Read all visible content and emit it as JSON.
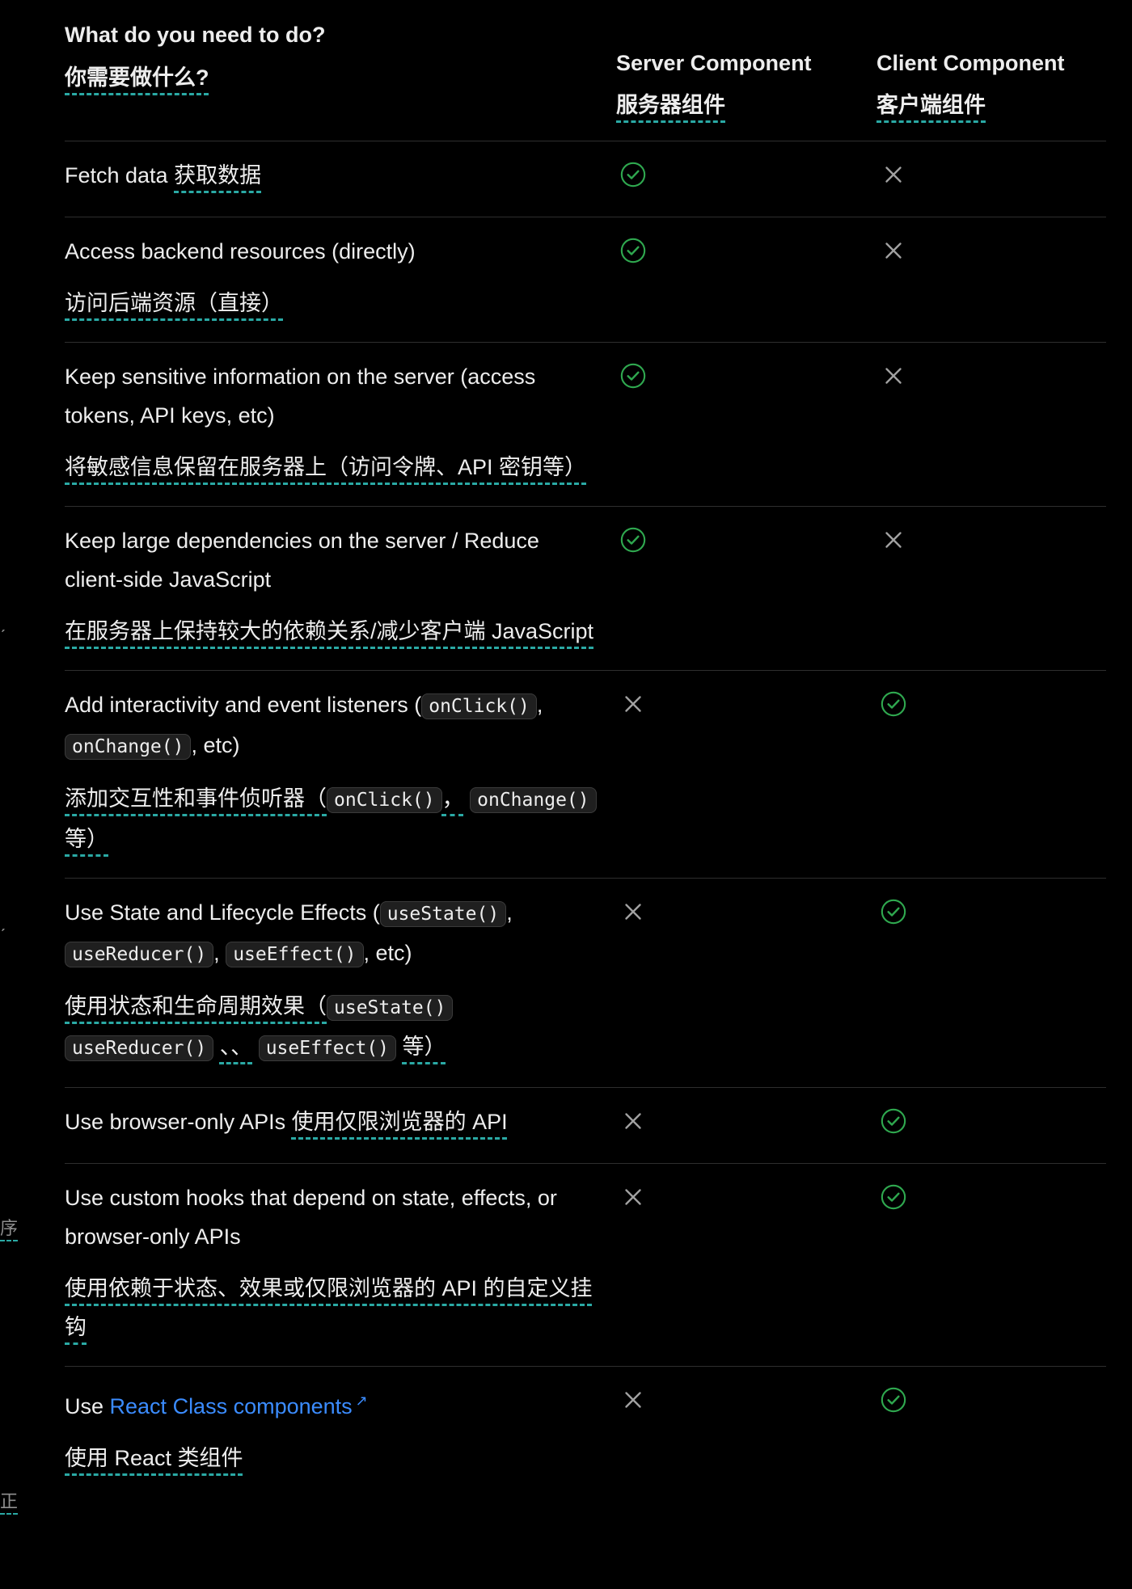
{
  "header": {
    "task_en": "What do you need to do?",
    "task_zh": "你需要做什么?",
    "server_en": "Server Component",
    "server_zh": "服务器组件",
    "client_en": "Client Component",
    "client_zh": "客户端组件"
  },
  "left_edge": {
    "mark1": "序",
    "mark2": "正"
  },
  "rows": [
    {
      "en": "Fetch data",
      "zh": "获取数据",
      "server": "check",
      "client": "x"
    },
    {
      "en": "Access backend resources (directly)",
      "zh": "访问后端资源（直接）",
      "server": "check",
      "client": "x"
    },
    {
      "en": "Keep sensitive information on the server (access tokens, API keys, etc)",
      "zh": "将敏感信息保留在服务器上（访问令牌、API 密钥等）",
      "server": "check",
      "client": "x"
    },
    {
      "en": "Keep large dependencies on the server / Reduce client-side JavaScript",
      "zh": "在服务器上保持较大的依赖关系/减少客户端 JavaScript",
      "server": "check",
      "client": "x"
    },
    {
      "en_a": "Add interactivity and event listeners (",
      "code1": "onClick()",
      "en_b": ",",
      "code2": "onChange()",
      "en_c": ", etc)",
      "zh_a": "添加交互性和事件侦听器（",
      "zh_b": "，",
      "zh_c": "等）",
      "server": "x",
      "client": "check"
    },
    {
      "en_a": "Use State and Lifecycle Effects (",
      "code1": "useState()",
      "en_b": ",",
      "code2": "useReducer()",
      "en_c": ",",
      "code3": "useEffect()",
      "en_d": ", etc)",
      "zh_a": "使用状态和生命周期效果（",
      "zh_b": "、、",
      "zh_c": "等）",
      "server": "x",
      "client": "check"
    },
    {
      "en": "Use browser-only APIs",
      "zh": "使用仅限浏览器的 API",
      "server": "x",
      "client": "check"
    },
    {
      "en": "Use custom hooks that depend on state, effects, or browser-only APIs",
      "zh": "使用依赖于状态、效果或仅限浏览器的 API 的自定义挂钩",
      "server": "x",
      "client": "check"
    },
    {
      "en_a": "Use",
      "link": "React Class components",
      "link_icon": "↗",
      "zh": "使用 React 类组件",
      "server": "x",
      "client": "check"
    }
  ],
  "colors": {
    "check": "#2fa84f",
    "x": "#a1a1a1",
    "link": "#3b8cff",
    "underline": "#2aa9a4"
  }
}
